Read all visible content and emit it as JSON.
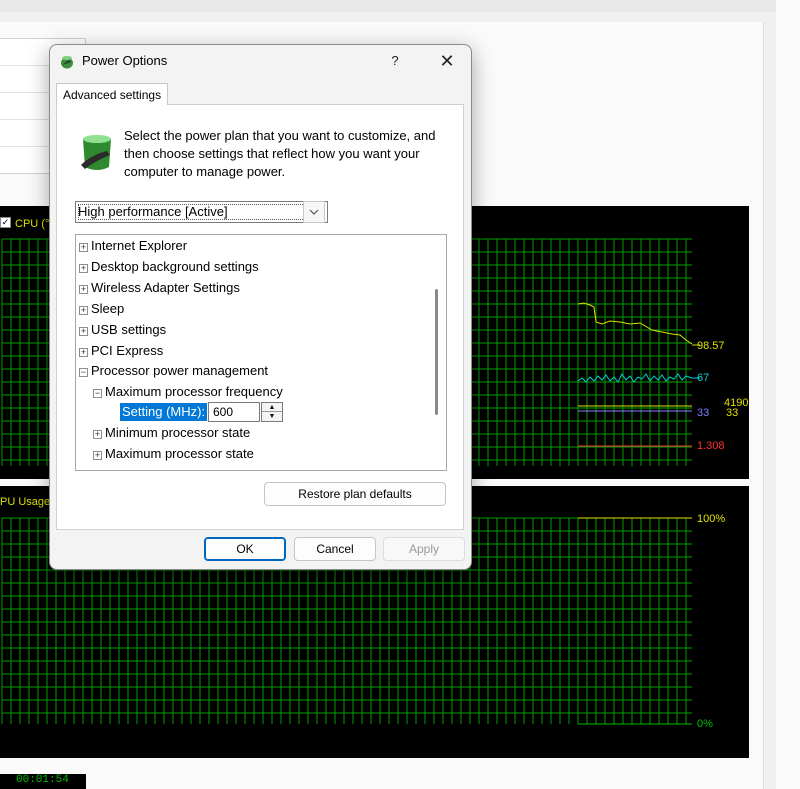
{
  "background": {
    "cpu_graph_label": "CPU (°",
    "usage_graph_label": "PU Usage",
    "legend_values": {
      "temp": "98.57",
      "cyan": "67",
      "blue": "33",
      "yellow_clock": "4190",
      "yellow_small": "33",
      "red": "1.308"
    },
    "usage_axis": {
      "top": "100%",
      "bottom": "0%"
    },
    "timer": "00:01:54",
    "colors": {
      "grid": "#00a000",
      "yellow": "#e0e000",
      "cyan": "#00d0d0",
      "red": "#ff3030",
      "blue": "#8080ff"
    }
  },
  "dialog": {
    "title": "Power Options",
    "help_glyph": "?",
    "close_glyph": "✕",
    "tab_label": "Advanced settings",
    "description": "Select the power plan that you want to customize, and then choose settings that reflect how you want your computer to manage power.",
    "plan_selected": "High performance [Active]",
    "tree": {
      "items": [
        {
          "label": "Internet Explorer",
          "expander": "⊞"
        },
        {
          "label": "Desktop background settings",
          "expander": "⊞"
        },
        {
          "label": "Wireless Adapter Settings",
          "expander": "⊞"
        },
        {
          "label": "Sleep",
          "expander": "⊞"
        },
        {
          "label": "USB settings",
          "expander": "⊞"
        },
        {
          "label": "PCI Express",
          "expander": "⊞"
        },
        {
          "label": "Processor power management",
          "expander": "⊟"
        },
        {
          "label": "Maximum processor frequency",
          "expander": "⊟"
        },
        {
          "label": "Minimum processor state",
          "expander": "⊞"
        },
        {
          "label": "Maximum processor state",
          "expander": "⊞"
        }
      ],
      "setting_label": "Setting (MHz):",
      "setting_value": "600"
    },
    "buttons": {
      "restore": "Restore plan defaults",
      "ok": "OK",
      "cancel": "Cancel",
      "apply": "Apply"
    }
  }
}
